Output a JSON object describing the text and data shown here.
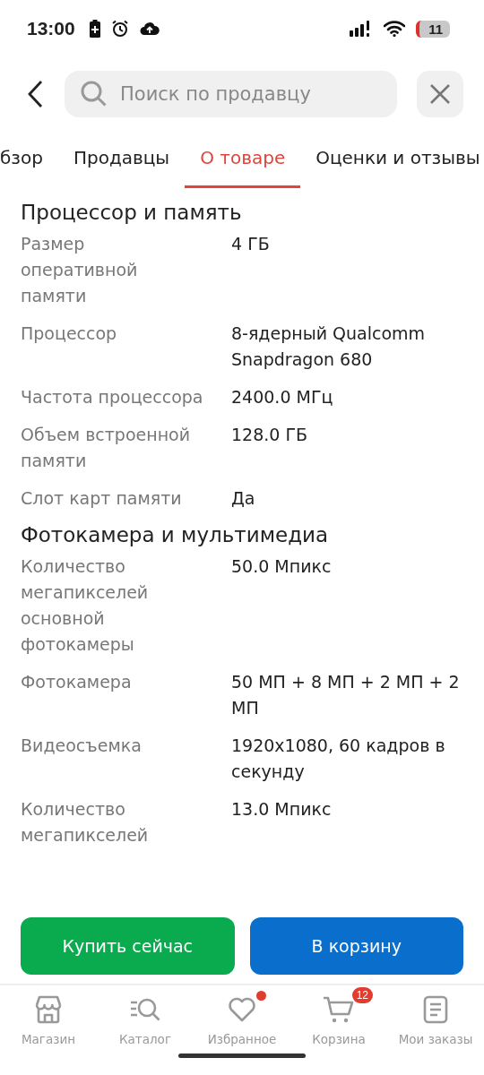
{
  "status_bar": {
    "time": "13:00",
    "battery": "11"
  },
  "search": {
    "placeholder": "Поиск по продавцу"
  },
  "tabs": [
    {
      "label": "бзор",
      "selected": false
    },
    {
      "label": "Продавцы",
      "selected": false
    },
    {
      "label": "О товаре",
      "selected": true
    },
    {
      "label": "Оценки и отзывы",
      "selected": false
    }
  ],
  "sections": [
    {
      "title": "Процессор и память",
      "rows": [
        {
          "label": "Размер оперативной памяти",
          "value": "4 ГБ"
        },
        {
          "label": "Процессор",
          "value": "8-ядерный Qualcomm Snapdragon 680"
        },
        {
          "label": "Частота процессора",
          "value": "2400.0 МГц"
        },
        {
          "label": "Объем встроенной памяти",
          "value": "128.0 ГБ"
        },
        {
          "label": "Слот карт памяти",
          "value": "Да"
        }
      ]
    },
    {
      "title": "Фотокамера и мультимедиа",
      "rows": [
        {
          "label": "Количество мегапикселей основной фотокамеры",
          "value": "50.0 Мпикс"
        },
        {
          "label": "Фотокамера",
          "value": "50 МП + 8 МП + 2 МП + 2 МП"
        },
        {
          "label": "Видеосъемка",
          "value": "1920x1080, 60 кадров в секунду"
        },
        {
          "label": "Количество мегапикселей",
          "value": "13.0 Мпикс"
        }
      ]
    }
  ],
  "actions": [
    {
      "label": "Купить сейчас",
      "kind": "buy"
    },
    {
      "label": "В корзину",
      "kind": "cart"
    }
  ],
  "nav": [
    {
      "label": "Магазин",
      "kind": "shop",
      "dot": false
    },
    {
      "label": "Каталог",
      "kind": "catalog",
      "dot": false
    },
    {
      "label": "Избранное",
      "kind": "heart",
      "dot": true
    },
    {
      "label": "Корзина",
      "kind": "cart",
      "dot": false,
      "badge": "12"
    },
    {
      "label": "Мои заказы",
      "kind": "orders",
      "dot": false
    }
  ]
}
